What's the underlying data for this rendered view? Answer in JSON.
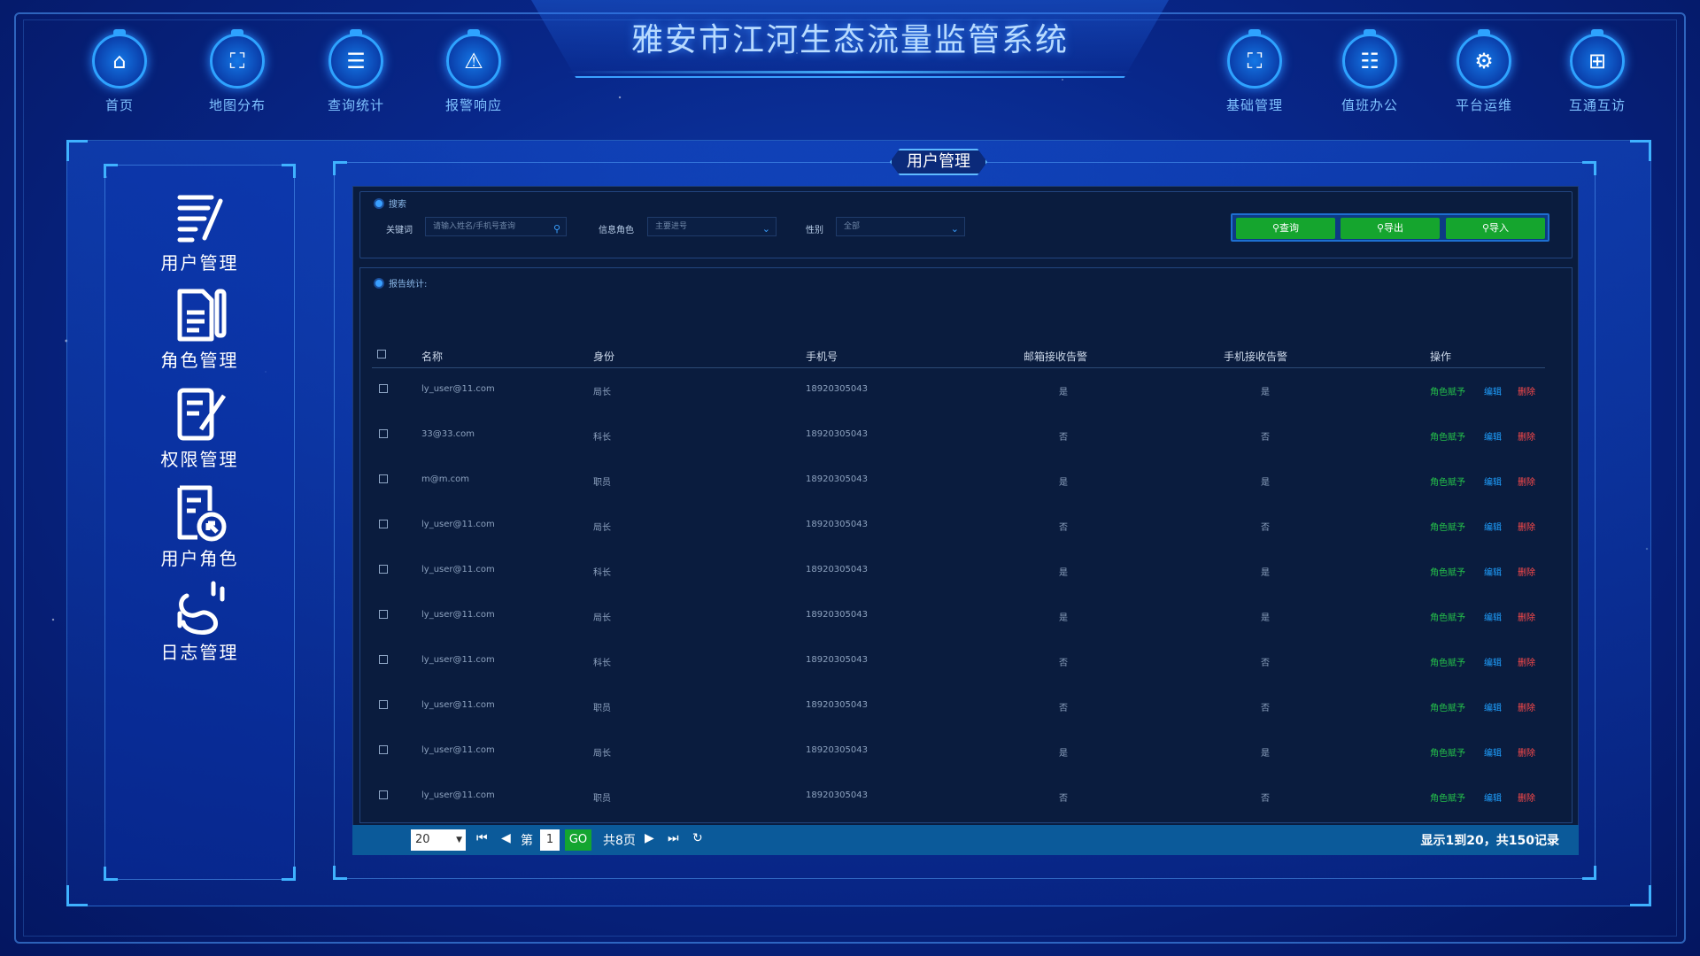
{
  "app": {
    "title": "雅安市江河生态流量监管系统"
  },
  "nav": [
    {
      "label": "首页",
      "icon": "home-icon"
    },
    {
      "label": "地图分布",
      "icon": "map-icon"
    },
    {
      "label": "查询统计",
      "icon": "stats-icon"
    },
    {
      "label": "报警响应",
      "icon": "alarm-icon"
    },
    {
      "label": "基础管理",
      "icon": "base-manage-icon"
    },
    {
      "label": "值班办公",
      "icon": "duty-icon"
    },
    {
      "label": "平台运维",
      "icon": "maintenance-icon"
    },
    {
      "label": "互通互访",
      "icon": "interconnect-icon"
    }
  ],
  "sidebar": {
    "items": [
      {
        "label": "用户管理",
        "icon": "user-manage-icon"
      },
      {
        "label": "角色管理",
        "icon": "role-manage-icon"
      },
      {
        "label": "权限管理",
        "icon": "permission-icon"
      },
      {
        "label": "用户角色",
        "icon": "user-role-icon"
      },
      {
        "label": "日志管理",
        "icon": "log-icon"
      }
    ]
  },
  "content": {
    "title": "用户管理"
  },
  "search": {
    "section_title": "搜索",
    "keyword_label": "关键词",
    "keyword_placeholder": "请输入姓名/手机号查询",
    "role_label": "信息角色",
    "role_value": "主要进号",
    "gender_label": "性别",
    "gender_value": "全部",
    "buttons": {
      "query": "查询",
      "export": "导出",
      "import": "导入"
    }
  },
  "stats": {
    "section_title": "报告统计:"
  },
  "table": {
    "headers": [
      "名称",
      "身份",
      "手机号",
      "邮箱接收告警",
      "手机接收告警",
      "操作"
    ],
    "ops": {
      "role": "角色赋予",
      "edit": "编辑",
      "del": "删除"
    },
    "rows": [
      [
        "ly_user@11.com",
        "局长",
        "18920305043",
        "是",
        "是"
      ],
      [
        "33@33.com",
        "科长",
        "18920305043",
        "否",
        "否"
      ],
      [
        "m@m.com",
        "职员",
        "18920305043",
        "是",
        "是"
      ],
      [
        "ly_user@11.com",
        "局长",
        "18920305043",
        "否",
        "否"
      ],
      [
        "ly_user@11.com",
        "科长",
        "18920305043",
        "是",
        "是"
      ],
      [
        "ly_user@11.com",
        "局长",
        "18920305043",
        "是",
        "是"
      ],
      [
        "ly_user@11.com",
        "科长",
        "18920305043",
        "否",
        "否"
      ],
      [
        "ly_user@11.com",
        "职员",
        "18920305043",
        "否",
        "否"
      ],
      [
        "ly_user@11.com",
        "局长",
        "18920305043",
        "是",
        "是"
      ],
      [
        "ly_user@11.com",
        "职员",
        "18920305043",
        "否",
        "否"
      ]
    ]
  },
  "pager": {
    "page_size": "20",
    "page_prefix": "第",
    "current_page": "1",
    "go": "GO",
    "total_pages": "共8页",
    "summary": "显示1到20，共150记录"
  }
}
